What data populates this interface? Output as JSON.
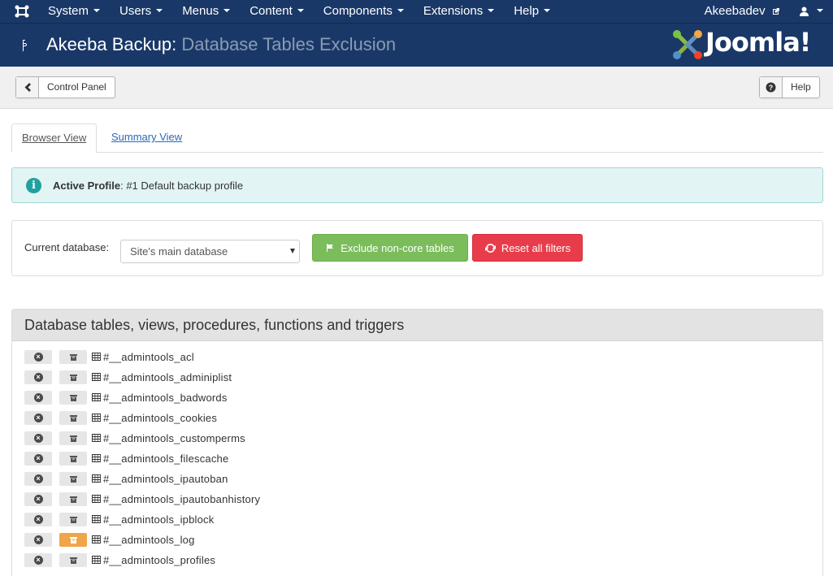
{
  "nav": {
    "menu": [
      "System",
      "Users",
      "Menus",
      "Content",
      "Components",
      "Extensions",
      "Help"
    ],
    "user": "Akeebadev"
  },
  "header": {
    "app": "Akeeba Backup:",
    "page": "Database Tables Exclusion",
    "logo_text": "Joomla!"
  },
  "toolbar": {
    "back_label": "Control Panel",
    "help_label": "Help"
  },
  "tabs": [
    "Browser View",
    "Summary View"
  ],
  "alert": {
    "label": "Active Profile",
    "value": ": #1 Default backup profile"
  },
  "filter": {
    "label": "Current database:",
    "selected": "Site's main database",
    "exclude_button": "Exclude non-core tables",
    "reset_button": "Reset all filters"
  },
  "panel": {
    "title": "Database tables, views, procedures, functions and triggers"
  },
  "tables": [
    {
      "name": "#__admintools_acl",
      "data_excluded": false
    },
    {
      "name": "#__admintools_adminiplist",
      "data_excluded": false
    },
    {
      "name": "#__admintools_badwords",
      "data_excluded": false
    },
    {
      "name": "#__admintools_cookies",
      "data_excluded": false
    },
    {
      "name": "#__admintools_customperms",
      "data_excluded": false
    },
    {
      "name": "#__admintools_filescache",
      "data_excluded": false
    },
    {
      "name": "#__admintools_ipautoban",
      "data_excluded": false
    },
    {
      "name": "#__admintools_ipautobanhistory",
      "data_excluded": false
    },
    {
      "name": "#__admintools_ipblock",
      "data_excluded": false
    },
    {
      "name": "#__admintools_log",
      "data_excluded": true
    },
    {
      "name": "#__admintools_profiles",
      "data_excluded": false
    }
  ],
  "colors": {
    "navbar": "#1a3867",
    "exclude_green": "#7bbd5b",
    "reset_red": "#e93c4a",
    "active_orange": "#f0a54a",
    "info_teal": "#20a1a0"
  }
}
